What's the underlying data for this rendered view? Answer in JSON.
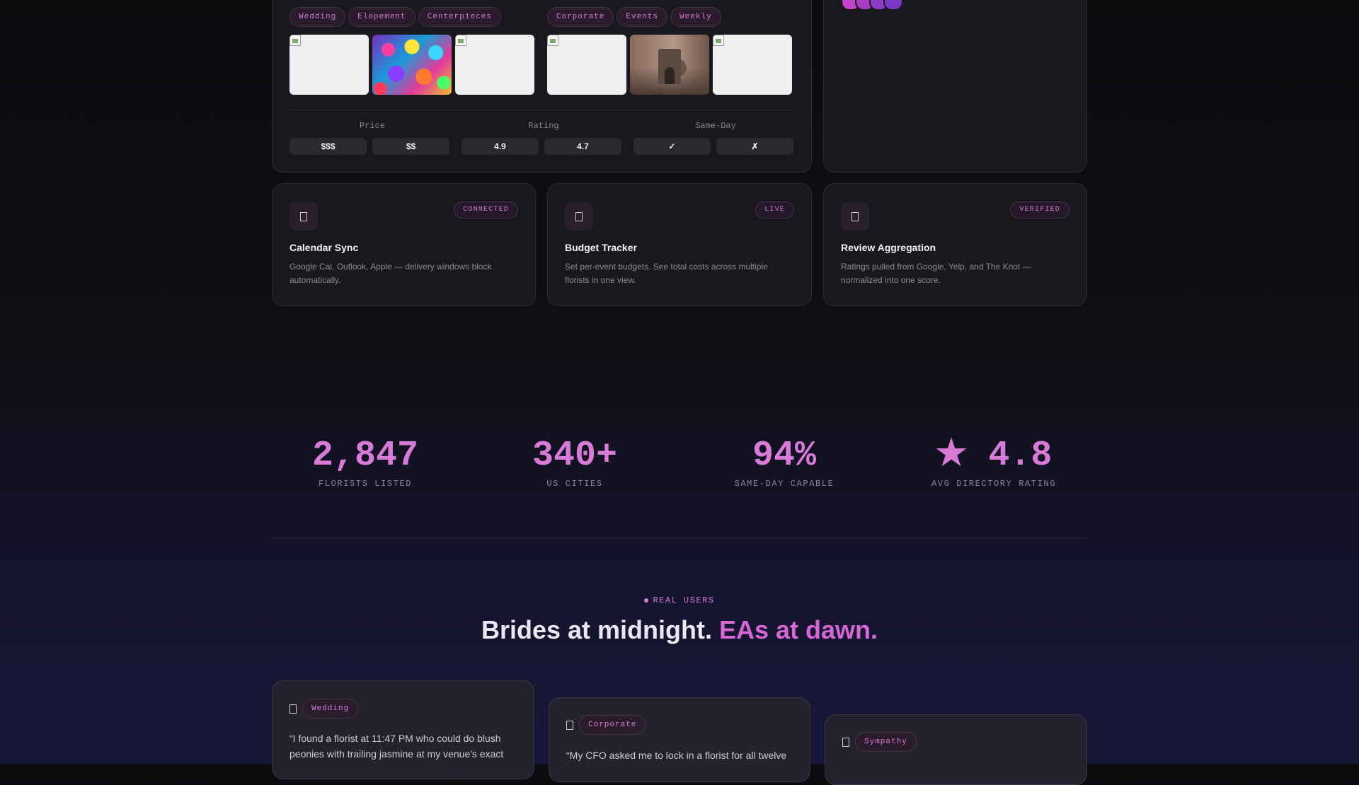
{
  "compare": {
    "left_tags": [
      "Wedding",
      "Elopement",
      "Centerpieces"
    ],
    "right_tags": [
      "Corporate",
      "Events",
      "Weekly"
    ],
    "columns": [
      {
        "label": "Price",
        "left": "$$$",
        "right": "$$"
      },
      {
        "label": "Rating",
        "left": "4.9",
        "right": "4.7"
      },
      {
        "label": "Same-Day",
        "left": "✓",
        "right": "✗"
      }
    ]
  },
  "features": [
    {
      "icon": "calendar-icon",
      "badge": "CONNECTED",
      "title": "Calendar Sync",
      "desc": "Google Cal, Outlook, Apple — delivery windows block automatically."
    },
    {
      "icon": "wallet-icon",
      "badge": "LIVE",
      "title": "Budget Tracker",
      "desc": "Set per-event budgets. See total costs across multiple florists in one view."
    },
    {
      "icon": "star-icon",
      "badge": "VERIFIED",
      "title": "Review Aggregation",
      "desc": "Ratings pulled from Google, Yelp, and The Knot — normalized into one score."
    }
  ],
  "stats": [
    {
      "value": "2,847",
      "label": "FLORISTS LISTED"
    },
    {
      "value": "340+",
      "label": "US CITIES"
    },
    {
      "value": "94%",
      "label": "SAME-DAY CAPABLE"
    },
    {
      "value": "★ 4.8",
      "label": "AVG DIRECTORY RATING"
    }
  ],
  "testimonials": {
    "eyebrow": "REAL USERS",
    "headline_main": "Brides at midnight. ",
    "headline_accent": "EAs at dawn.",
    "cards": [
      {
        "tag": "Wedding",
        "quote_line1": "“I found a florist at 11:47 PM who could do blush",
        "quote_line2": "peonies with trailing jasmine at my venue's exact"
      },
      {
        "tag": "Corporate",
        "quote_line1": "“My CFO asked me to lock in a florist for all twelve",
        "quote_line2": ""
      },
      {
        "tag": "Sympathy",
        "quote_line1": "",
        "quote_line2": ""
      }
    ]
  },
  "colors": {
    "accent": "#d67ad3",
    "background": "#0c0c0f",
    "card": "#19181d"
  }
}
